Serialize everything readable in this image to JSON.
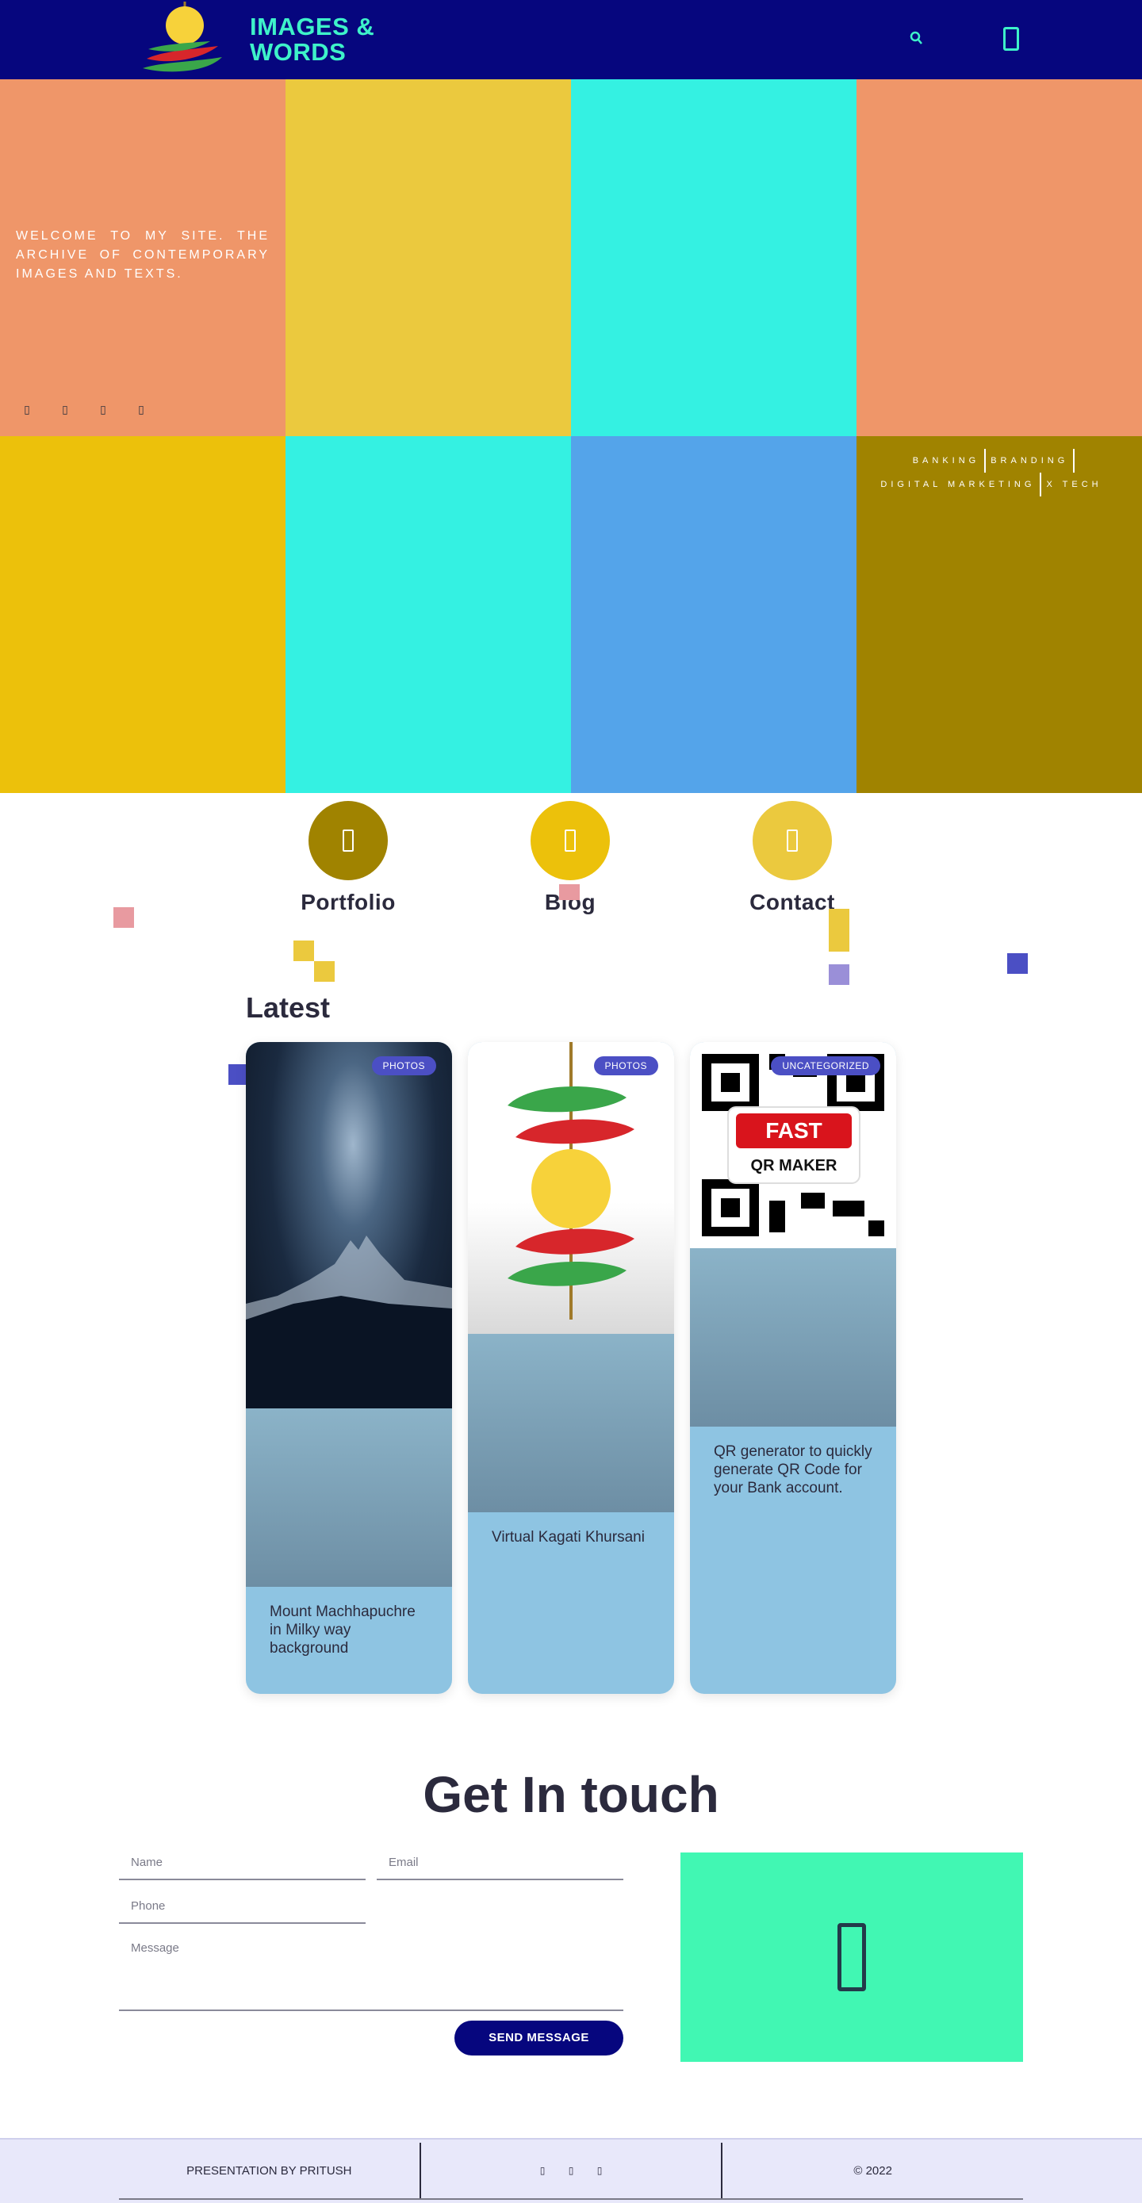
{
  "header": {
    "logo_text_line1": "IMAGES &",
    "logo_text_line2": "WORDS",
    "search_icon": "search-icon",
    "menu_icon": "menu-icon"
  },
  "hero": {
    "welcome_text": "WELCOME TO MY SITE. THE ARCHIVE OF CONTEMPORARY IMAGES AND TEXTS.",
    "social_icons": [
      "facebook-icon",
      "twitter-icon",
      "instagram-icon",
      "linkedin-icon"
    ],
    "tagline_line1": [
      "BANKING",
      "BRANDING"
    ],
    "tagline_line2": [
      "DIGITAL MARKETING",
      "X TECH"
    ],
    "tile_colors": [
      "#ef9669",
      "#ebc93e",
      "#34f1e2",
      "#ef9669",
      "#ecc10b",
      "#34f1e2",
      "#54a4ea",
      "#a08300"
    ]
  },
  "nav_circles": [
    {
      "label": "Portfolio",
      "color": "#a08300",
      "icon": "portfolio-icon"
    },
    {
      "label": "Blog",
      "color": "#ecc10b",
      "icon": "blog-icon"
    },
    {
      "label": "Contact",
      "color": "#ebc93e",
      "icon": "contact-icon"
    }
  ],
  "latest": {
    "title": "Latest",
    "cards": [
      {
        "badge": "PHOTOS",
        "title": "Mount Machhapuchre in Milky way background"
      },
      {
        "badge": "PHOTOS",
        "title": "Virtual Kagati Khursani"
      },
      {
        "badge": "UNCATEGORIZED",
        "title": "QR generator to quickly generate QR Code for your Bank account.",
        "image_text_1": "FAST",
        "image_text_2": "QR MAKER"
      }
    ]
  },
  "contact": {
    "title": "Get In touch",
    "name_placeholder": "Name",
    "email_placeholder": "Email",
    "phone_placeholder": "Phone",
    "message_placeholder": "Message",
    "send_label": "SEND MESSAGE",
    "panel_icon": "mobile-phone-icon",
    "panel_color": "#41f7b3"
  },
  "footer": {
    "credit": "PRESENTATION BY PRITUSH",
    "social_icons": [
      "facebook-icon",
      "twitter-icon",
      "instagram-icon"
    ],
    "copyright": "© 2022"
  }
}
